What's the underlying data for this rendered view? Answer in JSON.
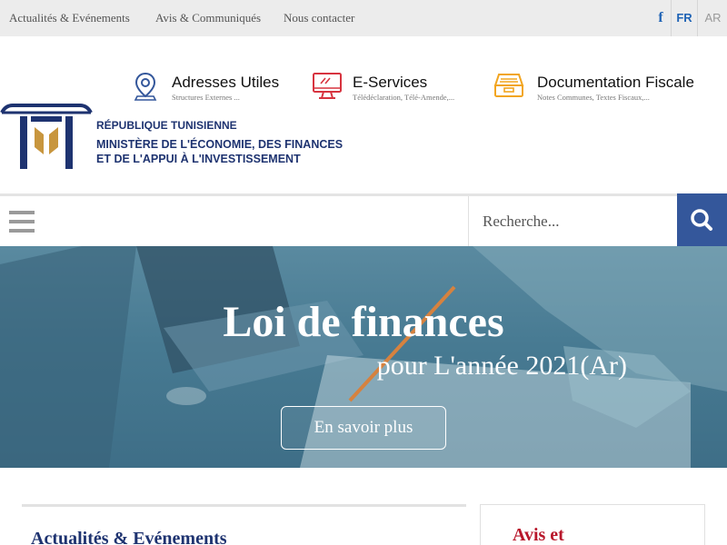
{
  "topbar": {
    "links": [
      "Actualités & Evénements",
      "Avis & Communiqués",
      "Nous contacter"
    ],
    "facebook": "f",
    "lang_fr": "FR",
    "lang_ar": "AR"
  },
  "header": {
    "items": [
      {
        "title": "Adresses Utiles",
        "subtitle": "Structures Externes ...",
        "icon": "map-pin-icon"
      },
      {
        "title": "E-Services",
        "subtitle": "Télédéclaration, Télé-Amende,...",
        "icon": "monitor-icon"
      },
      {
        "title": "Documentation Fiscale",
        "subtitle": "Notes Communes, Textes Fiscaux,...",
        "icon": "archive-box-icon"
      }
    ],
    "republic": "RÉPUBLIQUE TUNISIENNE",
    "ministry_line1": "MINISTÈRE DE L'ÉCONOMIE, DES FINANCES",
    "ministry_line2": "ET DE L'APPUI À L'INVESTISSEMENT",
    "colors": {
      "navy": "#1e3370",
      "gold": "#c8963e",
      "accent_blue": "#34579b",
      "red": "#d7333f",
      "orange": "#f2a51f"
    }
  },
  "nav": {
    "search_placeholder": "Recherche..."
  },
  "hero": {
    "title": "Loi de finances",
    "subtitle": "pour L'année 2021(Ar)",
    "button": "En savoir plus"
  },
  "content": {
    "news_title": "Actualités & Evénements",
    "avis_title": "Avis et"
  }
}
